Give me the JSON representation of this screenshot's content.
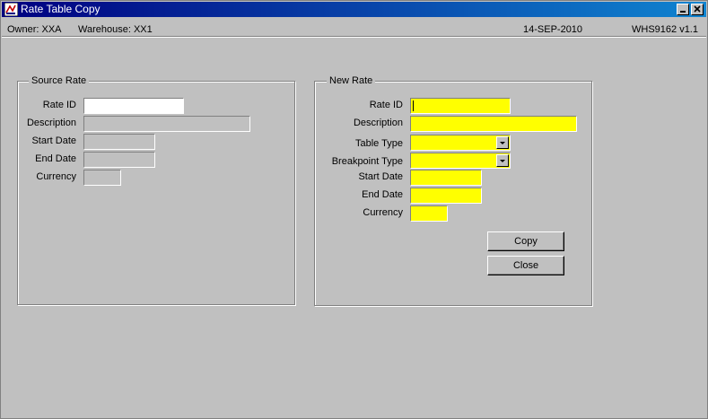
{
  "window": {
    "title": "Rate Table Copy",
    "minimize_glyph": "_",
    "close_glyph": "×"
  },
  "infobar": {
    "owner": "Owner:  XXA",
    "warehouse": "Warehouse:  XX1",
    "date": "14-SEP-2010",
    "version": "WHS9162  v1.1"
  },
  "source_rate": {
    "title": "Source Rate",
    "rate_id_label": "Rate ID",
    "description_label": "Description",
    "start_date_label": "Start Date",
    "end_date_label": "End Date",
    "currency_label": "Currency",
    "rate_id_value": "",
    "description_value": "",
    "start_date_value": "",
    "end_date_value": "",
    "currency_value": ""
  },
  "new_rate": {
    "title": "New Rate",
    "rate_id_label": "Rate ID",
    "description_label": "Description",
    "table_type_label": "Table Type",
    "breakpoint_type_label": "Breakpoint Type",
    "start_date_label": "Start Date",
    "end_date_label": "End Date",
    "currency_label": "Currency",
    "rate_id_value": "",
    "description_value": "",
    "table_type_value": "",
    "breakpoint_type_value": "",
    "start_date_value": "",
    "end_date_value": "",
    "currency_value": ""
  },
  "buttons": {
    "copy": "Copy",
    "close": "Close"
  },
  "colors": {
    "required_field": "#ffff00",
    "titlebar_start": "#000080",
    "titlebar_end": "#1084d0"
  }
}
